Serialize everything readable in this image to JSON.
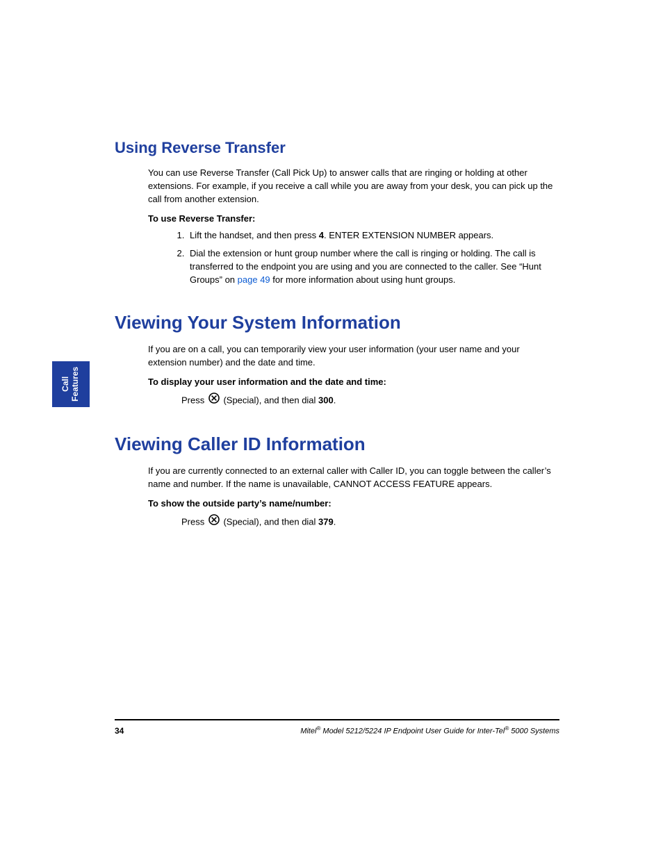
{
  "sideTab": {
    "line1": "Call",
    "line2": "Features"
  },
  "section1": {
    "heading": "Using Reverse Transfer",
    "intro": "You can use Reverse Transfer (Call Pick Up) to answer calls that are ringing or holding at other extensions. For example, if you receive a call while you are away from your desk, you can pick up the call from another extension.",
    "sub": "To use Reverse Transfer:",
    "step1_a": "Lift the handset, and then press ",
    "step1_b": "4",
    "step1_c": ". ENTER EXTENSION NUMBER appears.",
    "step2_a": "Dial the extension or hunt group number where the call is ringing or holding. The call is transferred to the endpoint you are using and you are connected to the caller. See “Hunt Groups” on ",
    "step2_link": "page 49",
    "step2_b": " for more information about using hunt groups."
  },
  "section2": {
    "heading": "Viewing Your System Information",
    "intro": "If you are on a call, you can temporarily view your user information (your user name and your extension number) and the date and time.",
    "sub": "To display your user information and the date and time:",
    "instr_a": "Press ",
    "instr_b": " (Special), and then dial ",
    "instr_c": "300",
    "instr_d": "."
  },
  "section3": {
    "heading": "Viewing Caller ID Information",
    "intro": "If you are currently connected to an external caller with Caller ID, you can toggle between the caller’s name and number. If the name is unavailable, CANNOT ACCESS FEATURE appears.",
    "sub": "To show the outside party’s name/number:",
    "instr_a": "Press ",
    "instr_b": " (Special), and then dial ",
    "instr_c": "379",
    "instr_d": "."
  },
  "footer": {
    "pageNumber": "34",
    "text_a": "Mitel",
    "text_b": " Model 5212/5224 IP Endpoint User Guide for Inter-Tel",
    "text_c": " 5000 Systems",
    "reg": "®"
  }
}
